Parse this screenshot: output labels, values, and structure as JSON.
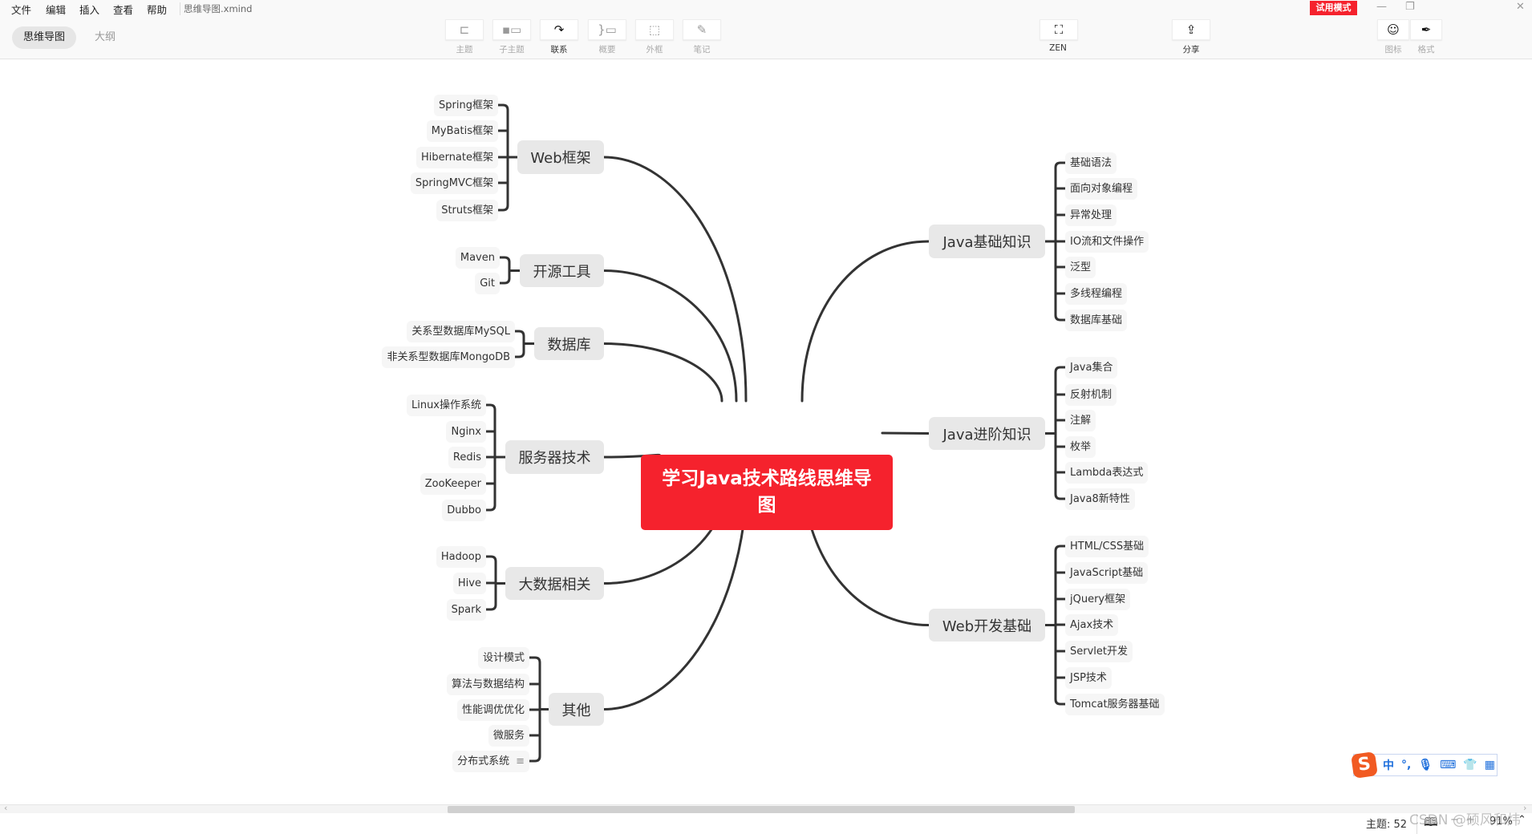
{
  "menu": [
    "文件",
    "编辑",
    "插入",
    "查看",
    "帮助"
  ],
  "file_name": "思维导图.xmind",
  "view_tabs": {
    "mindmap": "思维导图",
    "outline": "大纲"
  },
  "toolbar": [
    {
      "label": "主题",
      "icon": "topic-icon",
      "glyph": "⊏"
    },
    {
      "label": "子主题",
      "icon": "subtopic-icon",
      "glyph": "▪▭"
    },
    {
      "label": "联系",
      "icon": "relationship-icon",
      "glyph": "↷"
    },
    {
      "label": "概要",
      "icon": "summary-icon",
      "glyph": "}▭"
    },
    {
      "label": "外框",
      "icon": "boundary-icon",
      "glyph": "⬚"
    },
    {
      "label": "笔记",
      "icon": "note-icon",
      "glyph": "✎"
    }
  ],
  "zen": {
    "label": "ZEN",
    "glyph": "⛶"
  },
  "share": {
    "label": "分享",
    "glyph": "⇪"
  },
  "icons_panel": {
    "label": "图标",
    "glyph": "☺"
  },
  "format_panel": {
    "label": "格式",
    "glyph": "✒"
  },
  "trial_badge": "试用模式",
  "accent_color": "#f5222d",
  "mindmap": {
    "central": "学习Java技术路线思维导图",
    "left": [
      {
        "title": "Web框架",
        "children": [
          "Spring框架",
          "MyBatis框架",
          "Hibernate框架",
          "SpringMVC框架",
          "Struts框架"
        ]
      },
      {
        "title": "开源工具",
        "children": [
          "Maven",
          "Git"
        ]
      },
      {
        "title": "数据库",
        "children": [
          "关系型数据库MySQL",
          "非关系型数据库MongoDB"
        ]
      },
      {
        "title": "服务器技术",
        "children": [
          "Linux操作系统",
          "Nginx",
          "Redis",
          "ZooKeeper",
          "Dubbo"
        ]
      },
      {
        "title": "大数据相关",
        "children": [
          "Hadoop",
          "Hive",
          "Spark"
        ]
      },
      {
        "title": "其他",
        "children": [
          "设计模式",
          "算法与数据结构",
          "性能调优优化",
          "微服务",
          "分布式系统"
        ]
      }
    ],
    "right": [
      {
        "title": "Java基础知识",
        "children": [
          "基础语法",
          "面向对象编程",
          "异常处理",
          "IO流和文件操作",
          "泛型",
          "多线程编程",
          "数据库基础"
        ]
      },
      {
        "title": "Java进阶知识",
        "children": [
          "Java集合",
          "反射机制",
          "注解",
          "枚举",
          "Lambda表达式",
          "Java8新特性"
        ]
      },
      {
        "title": "Web开发基础",
        "children": [
          "HTML/CSS基础",
          "JavaScript基础",
          "jQuery框架",
          "Ajax技术",
          "Servlet开发",
          "JSP技术",
          "Tomcat服务器基础"
        ]
      }
    ]
  },
  "status": {
    "topic_count": "主题: 52",
    "zoom": "91%"
  },
  "watermark": "CSDN @硕风和炜",
  "ime": {
    "mode": "中",
    "punct": "°,"
  }
}
